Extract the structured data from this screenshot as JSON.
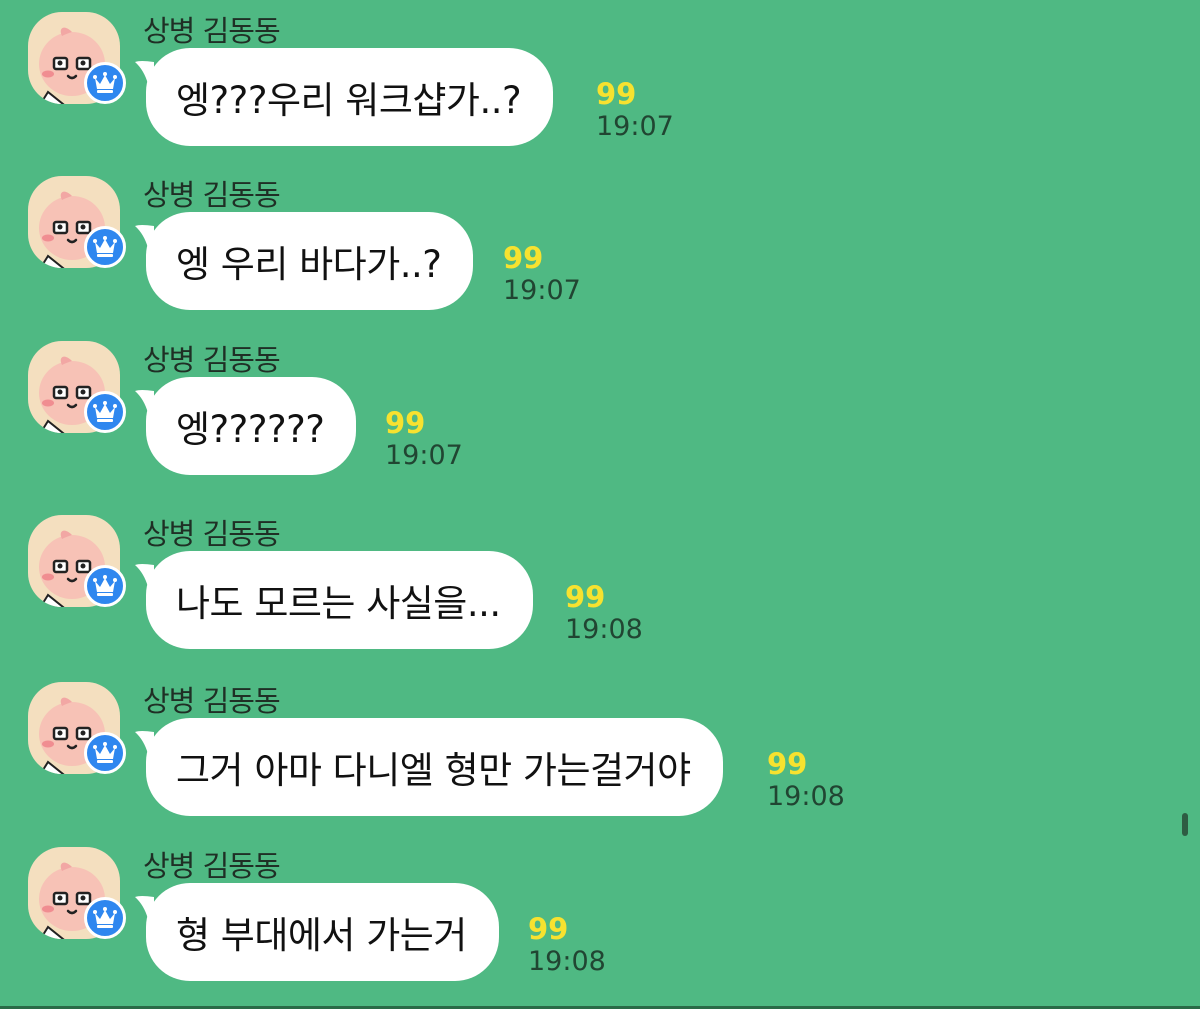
{
  "chat": {
    "background_color": "#4fb983",
    "messages": [
      {
        "sender": "상병 김동동",
        "text": "엥???우리 워크샵가..?",
        "unread": "99",
        "time": "19:07"
      },
      {
        "sender": "상병 김동동",
        "text": "엥 우리 바다가..?",
        "unread": "99",
        "time": "19:07"
      },
      {
        "sender": "상병 김동동",
        "text": "엥??????",
        "unread": "99",
        "time": "19:07"
      },
      {
        "sender": "상병 김동동",
        "text": "나도 모르는 사실을...",
        "unread": "99",
        "time": "19:08"
      },
      {
        "sender": "상병 김동동",
        "text": "그거 아마 다니엘 형만 가는걸거야",
        "unread": "99",
        "time": "19:08"
      },
      {
        "sender": "상병 김동동",
        "text": "형 부대에서 가는거",
        "unread": "99",
        "time": "19:08"
      }
    ]
  },
  "icons": {
    "avatar": "peach-character-avatar-icon",
    "badge": "crown-badge-icon"
  },
  "colors": {
    "unread_count": "#f7e22f",
    "badge": "#2f87ef",
    "bubble": "#ffffff"
  }
}
